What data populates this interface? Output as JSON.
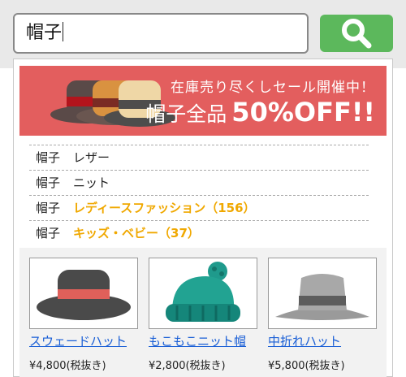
{
  "search": {
    "query": "帽子"
  },
  "banner": {
    "line1": "在庫売り尽くしセール開催中！",
    "line2_prefix": "帽子全品",
    "line2_highlight": "50%OFF!!"
  },
  "suggestions": [
    {
      "keyword": "帽子",
      "text": "レザー",
      "type": "keyword"
    },
    {
      "keyword": "帽子",
      "text": "ニット",
      "type": "keyword"
    },
    {
      "keyword": "帽子",
      "text": "レディースファッション（156）",
      "type": "category"
    },
    {
      "keyword": "帽子",
      "text": "キッズ・ベビー（37）",
      "type": "category"
    }
  ],
  "products": [
    {
      "name": "スウェードハット",
      "price": "¥4,800(税抜き)",
      "icon": "black-hat-icon"
    },
    {
      "name": "もこもこニット帽",
      "price": "¥2,800(税抜き)",
      "icon": "knit-cap-icon"
    },
    {
      "name": "中折れハット",
      "price": "¥5,800(税抜き)",
      "icon": "fedora-icon"
    }
  ],
  "colors": {
    "search_button": "#5cb85c",
    "banner": "#e35e5e",
    "category_text": "#f0a800",
    "link": "#1a5fd6"
  }
}
